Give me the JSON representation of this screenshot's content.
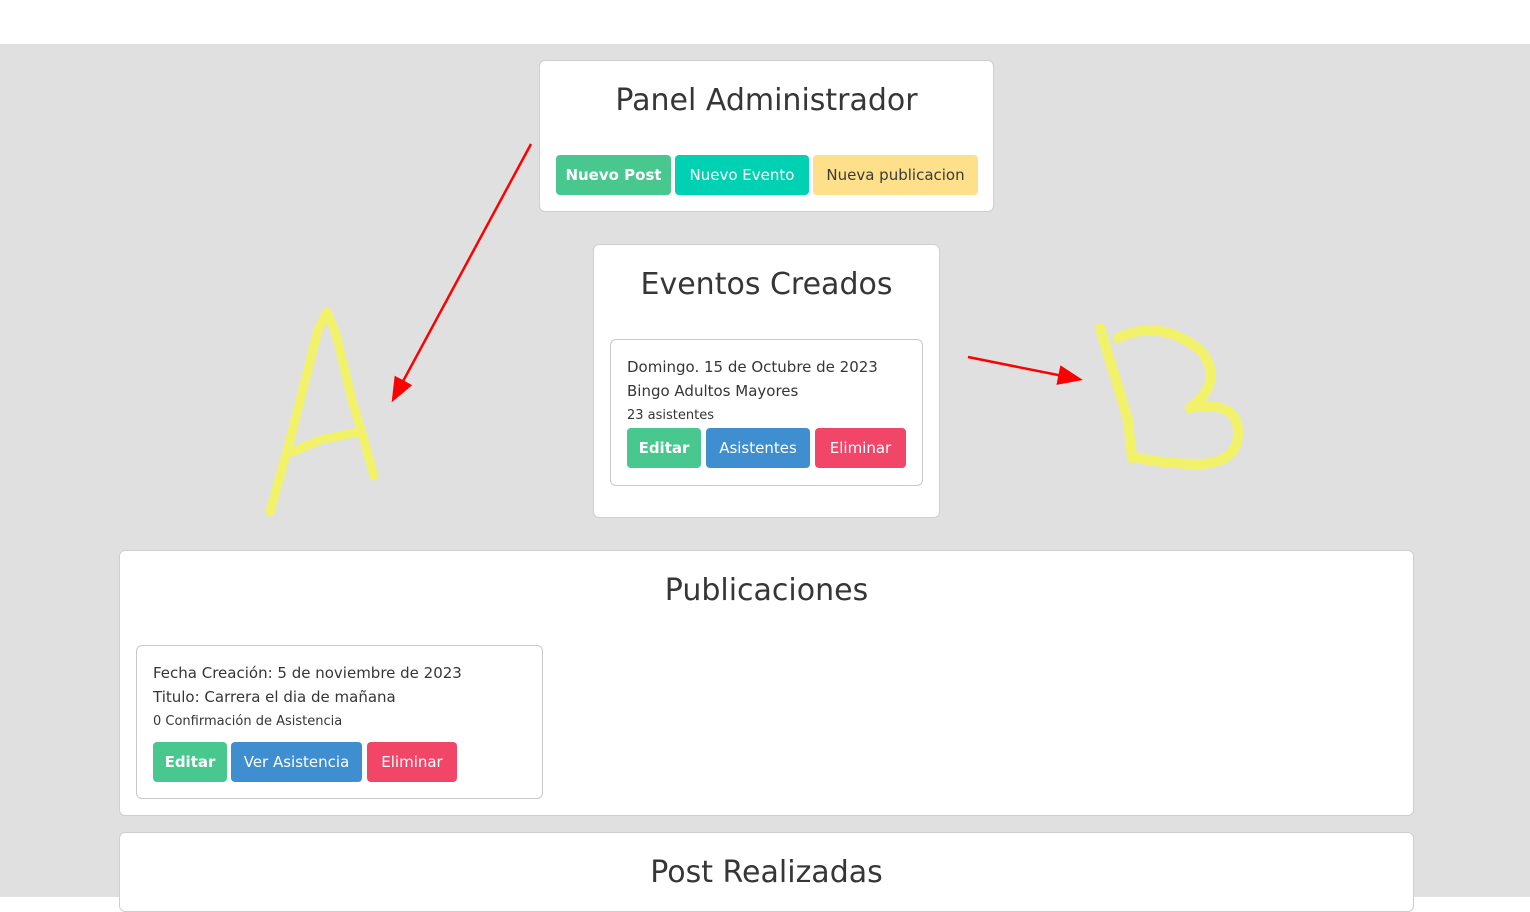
{
  "admin_panel": {
    "title": "Panel Administrador",
    "buttons": {
      "new_post": "Nuevo Post",
      "new_event": "Nuevo Evento",
      "new_publication": "Nueva publicacion"
    }
  },
  "events": {
    "title": "Eventos Creados",
    "items": [
      {
        "date": "Domingo. 15 de Octubre de 2023",
        "name": "Bingo Adultos Mayores",
        "attendees": "23 asistentes",
        "edit_label": "Editar",
        "attendees_label": "Asistentes",
        "delete_label": "Eliminar"
      }
    ]
  },
  "publications": {
    "title": "Publicaciones",
    "items": [
      {
        "created": "Fecha Creación: 5 de noviembre de 2023",
        "title": "Titulo: Carrera el dia de mañana",
        "confirmations": "0 Confirmación de Asistencia",
        "edit_label": "Editar",
        "view_label": "Ver Asistencia",
        "delete_label": "Eliminar"
      }
    ]
  },
  "posts": {
    "title": "Post Realizadas"
  },
  "annotations": {
    "label_a": "A",
    "label_b": "B",
    "arrow_color": "#ff0000",
    "marker_color": "#f2f26a"
  },
  "colors": {
    "success": "#48c78e",
    "primary": "#00d1b2",
    "warning": "#ffe08a",
    "info": "#3e8ed0",
    "danger": "#f14668",
    "page_background": "#e0e0e0"
  }
}
